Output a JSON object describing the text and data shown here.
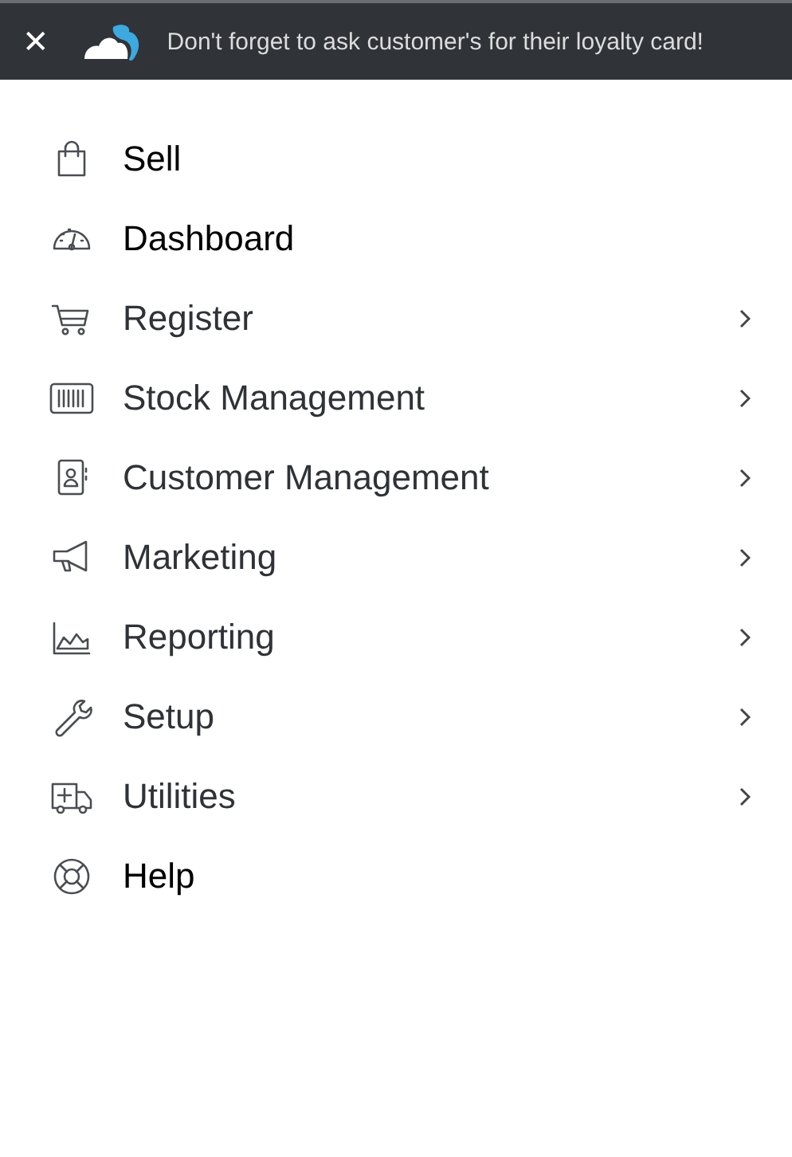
{
  "banner": {
    "close": "✕",
    "message": "Don't forget to ask customer's for their loyalty card!"
  },
  "menu": [
    {
      "label": "Sell",
      "expandable": false
    },
    {
      "label": "Dashboard",
      "expandable": false
    },
    {
      "label": "Register",
      "expandable": true
    },
    {
      "label": "Stock Management",
      "expandable": true
    },
    {
      "label": "Customer Management",
      "expandable": true
    },
    {
      "label": "Marketing",
      "expandable": true
    },
    {
      "label": "Reporting",
      "expandable": true
    },
    {
      "label": "Setup",
      "expandable": true
    },
    {
      "label": "Utilities",
      "expandable": true
    },
    {
      "label": "Help",
      "expandable": false
    }
  ]
}
